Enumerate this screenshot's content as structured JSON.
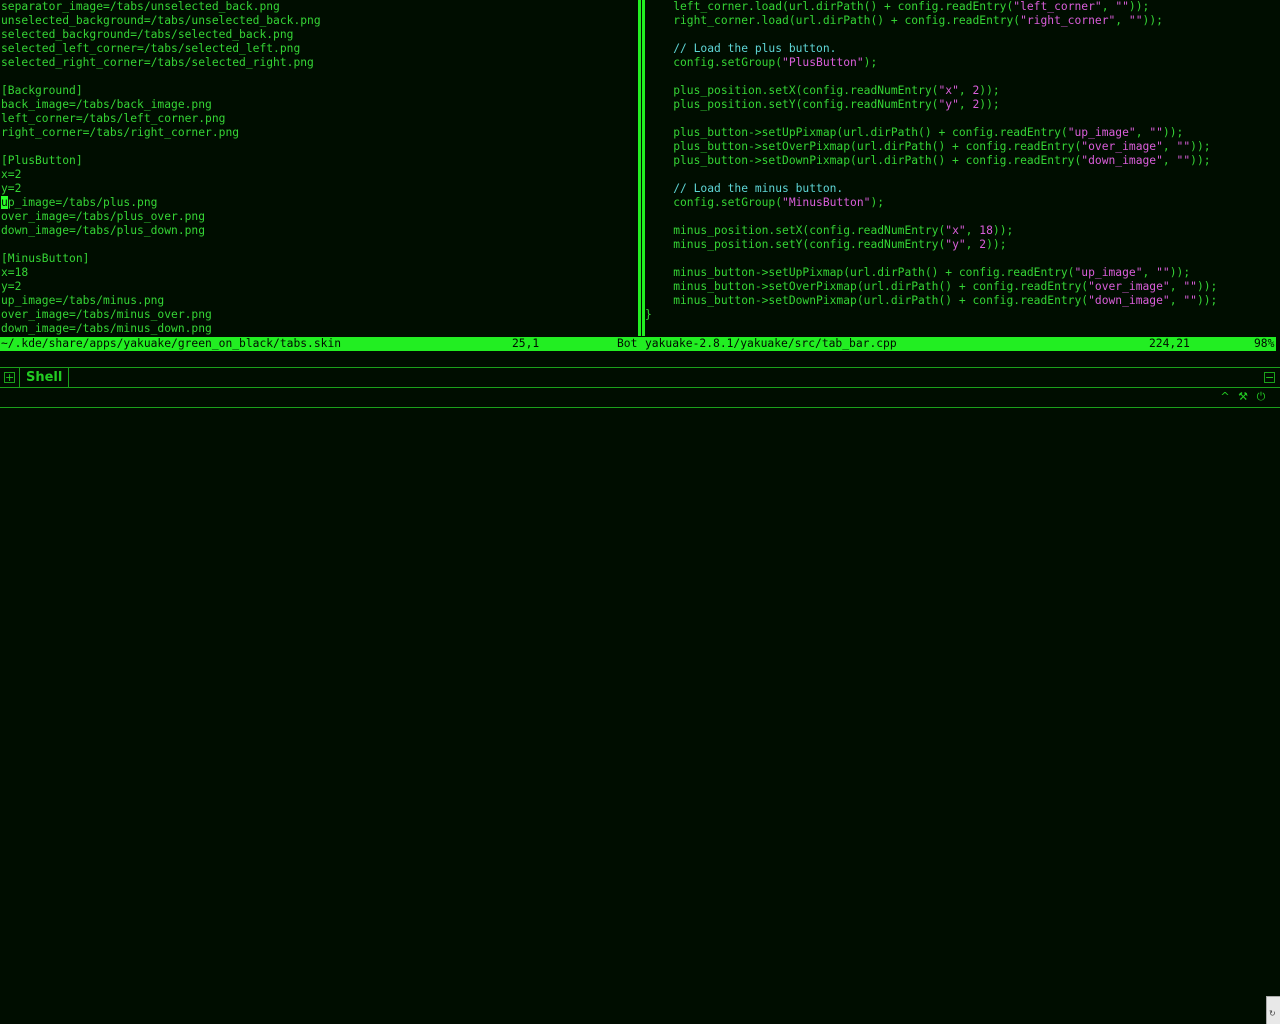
{
  "left_pane": {
    "lines": [
      "separator_image=/tabs/unselected_back.png",
      "unselected_background=/tabs/unselected_back.png",
      "selected_background=/tabs/selected_back.png",
      "selected_left_corner=/tabs/selected_left.png",
      "selected_right_corner=/tabs/selected_right.png",
      "",
      "[Background]",
      "back_image=/tabs/back_image.png",
      "left_corner=/tabs/left_corner.png",
      "right_corner=/tabs/right_corner.png",
      "",
      "[PlusButton]",
      "x=2",
      "y=2",
      "",
      "over_image=/tabs/plus_over.png",
      "down_image=/tabs/plus_down.png",
      "",
      "[MinusButton]",
      "x=18",
      "y=2",
      "up_image=/tabs/minus.png",
      "over_image=/tabs/minus_over.png",
      "down_image=/tabs/minus_down.png"
    ],
    "cursor_line_char": "u",
    "cursor_line_rest": "p_image=/tabs/plus.png"
  },
  "right_pane": {
    "l0": "    left_corner.load(url.dirPath() + config.readEntry(",
    "l0s": "\"left_corner\"",
    "l0b": ", ",
    "l0s2": "\"\"",
    "l0e": "));",
    "l1": "    right_corner.load(url.dirPath() + config.readEntry(",
    "l1s": "\"right_corner\"",
    "l1b": ", ",
    "l1s2": "\"\"",
    "l1e": "));",
    "l3c": "    // Load the plus button.",
    "l4": "    config.setGroup(",
    "l4s": "\"PlusButton\"",
    "l4e": ");",
    "l6": "    plus_position.setX(config.readNumEntry(",
    "l6s": "\"x\"",
    "l6b": ", ",
    "l6n": "2",
    "l6e": "));",
    "l7": "    plus_position.setY(config.readNumEntry(",
    "l7s": "\"y\"",
    "l7b": ", ",
    "l7n": "2",
    "l7e": "));",
    "l9": "    plus_button->setUpPixmap(url.dirPath() + config.readEntry(",
    "l9s": "\"up_image\"",
    "l9b": ", ",
    "l9s2": "\"\"",
    "l9e": "));",
    "l10": "    plus_button->setOverPixmap(url.dirPath() + config.readEntry(",
    "l10s": "\"over_image\"",
    "l10b": ", ",
    "l10s2": "\"\"",
    "l10e": "));",
    "l11": "    plus_button->setDownPixmap(url.dirPath() + config.readEntry(",
    "l11s": "\"down_image\"",
    "l11b": ", ",
    "l11s2": "\"\"",
    "l11e": "));",
    "l13c": "    // Load the minus button.",
    "l14": "    config.setGroup(",
    "l14s": "\"MinusButton\"",
    "l14e": ");",
    "l16": "    minus_position.setX(config.readNumEntry(",
    "l16s": "\"x\"",
    "l16b": ", ",
    "l16n": "18",
    "l16e": "));",
    "l17": "    minus_position.setY(config.readNumEntry(",
    "l17s": "\"y\"",
    "l17b": ", ",
    "l17n": "2",
    "l17e": "));",
    "l19": "    minus_button->setUpPixmap(url.dirPath() + config.readEntry(",
    "l19s": "\"up_image\"",
    "l19b": ", ",
    "l19s2": "\"\"",
    "l19e": "));",
    "l20": "    minus_button->setOverPixmap(url.dirPath() + config.readEntry(",
    "l20s": "\"over_image\"",
    "l20b": ", ",
    "l20s2": "\"\"",
    "l20e": "));",
    "l21": "    minus_button->setDownPixmap(url.dirPath() + config.readEntry(",
    "l21s": "\"down_image\"",
    "l21b": ", ",
    "l21s2": "\"\"",
    "l21e": "));",
    "l22": "}"
  },
  "status": {
    "left_file": "~/.kde/share/apps/yakuake/green_on_black/tabs.skin",
    "left_pos": "25,1",
    "left_scroll": "Bot",
    "right_file": "yakuake-2.8.1/yakuake/src/tab_bar.cpp",
    "right_pos": "224,21",
    "right_scroll": "98%"
  },
  "tabbar": {
    "add_tab_symbol": "+",
    "tab_label": "Shell",
    "close_tab_symbol": "−"
  },
  "toolbar": {
    "up_symbol": "^",
    "config_symbol": "⚒",
    "quit_symbol": "⏻"
  },
  "colors": {
    "background": "#000d00",
    "text": "#35d435",
    "accent": "#22ee22",
    "comment": "#5ed5d5",
    "string": "#d95ed9"
  }
}
